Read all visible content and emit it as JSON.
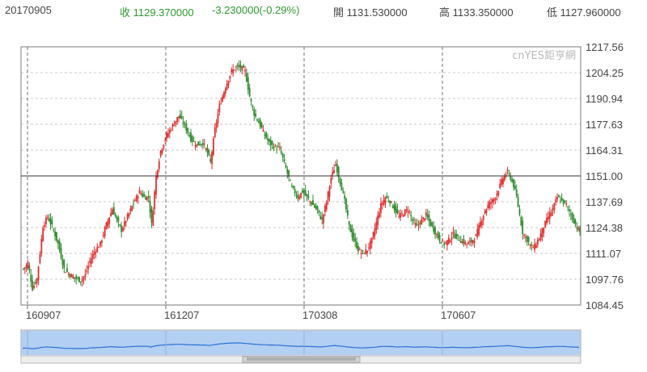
{
  "header": {
    "date": "20170905",
    "close": "收 1129.370000",
    "change": "-3.230000(-0.29%)",
    "open": "開 1131.530000",
    "high": "高 1133.350000",
    "low": "低 1127.960000"
  },
  "watermark": "cnYES鉅亨網",
  "colors": {
    "up": "#e03030",
    "down": "#2e8b2e",
    "navigator_fill": "#9cc3ef",
    "navigator_line": "#2a6fd6"
  },
  "chart_data": {
    "type": "candlestick",
    "y_ticks": [
      "1217.56",
      "1204.25",
      "1190.94",
      "1177.63",
      "1164.31",
      "1151.00",
      "1137.69",
      "1124.38",
      "1111.07",
      "1097.76",
      "1084.45"
    ],
    "ylim": [
      1084.45,
      1217.56
    ],
    "x_ticks": [
      "160907",
      "161207",
      "170308",
      "170607"
    ],
    "reference_line": 1151.0,
    "grid": true,
    "price_path": [
      [
        0,
        1103
      ],
      [
        3,
        1106
      ],
      [
        6,
        1093
      ],
      [
        9,
        1098
      ],
      [
        13,
        1125
      ],
      [
        16,
        1130
      ],
      [
        19,
        1125
      ],
      [
        23,
        1116
      ],
      [
        27,
        1103
      ],
      [
        31,
        1100
      ],
      [
        35,
        1098
      ],
      [
        38,
        1097
      ],
      [
        41,
        1100
      ],
      [
        44,
        1107
      ],
      [
        47,
        1112
      ],
      [
        51,
        1116
      ],
      [
        55,
        1126
      ],
      [
        59,
        1134
      ],
      [
        62,
        1128
      ],
      [
        65,
        1123
      ],
      [
        69,
        1130
      ],
      [
        73,
        1137
      ],
      [
        77,
        1143
      ],
      [
        80,
        1140
      ],
      [
        83,
        1140
      ],
      [
        85,
        1126
      ],
      [
        88,
        1151
      ],
      [
        91,
        1164
      ],
      [
        95,
        1172
      ],
      [
        99,
        1177
      ],
      [
        103,
        1182
      ],
      [
        107,
        1177
      ],
      [
        111,
        1170
      ],
      [
        115,
        1167
      ],
      [
        119,
        1168
      ],
      [
        122,
        1163
      ],
      [
        124,
        1158
      ],
      [
        127,
        1175
      ],
      [
        130,
        1187
      ],
      [
        134,
        1197
      ],
      [
        138,
        1205
      ],
      [
        141,
        1207
      ],
      [
        144,
        1207
      ],
      [
        147,
        1205
      ],
      [
        150,
        1192
      ],
      [
        153,
        1183
      ],
      [
        157,
        1177
      ],
      [
        160,
        1172
      ],
      [
        163,
        1168
      ],
      [
        166,
        1166
      ],
      [
        170,
        1165
      ],
      [
        174,
        1155
      ],
      [
        178,
        1145
      ],
      [
        182,
        1140
      ],
      [
        185,
        1143
      ],
      [
        188,
        1140
      ],
      [
        191,
        1137
      ],
      [
        195,
        1133
      ],
      [
        198,
        1128
      ],
      [
        201,
        1138
      ],
      [
        204,
        1150
      ],
      [
        207,
        1157
      ],
      [
        210,
        1148
      ],
      [
        213,
        1138
      ],
      [
        216,
        1125
      ],
      [
        219,
        1118
      ],
      [
        222,
        1113
      ],
      [
        225,
        1111
      ],
      [
        228,
        1113
      ],
      [
        231,
        1118
      ],
      [
        234,
        1127
      ],
      [
        237,
        1136
      ],
      [
        240,
        1140
      ],
      [
        243,
        1138
      ],
      [
        246,
        1134
      ],
      [
        249,
        1130
      ],
      [
        252,
        1132
      ],
      [
        255,
        1134
      ],
      [
        258,
        1128
      ],
      [
        261,
        1125
      ],
      [
        264,
        1128
      ],
      [
        267,
        1131
      ],
      [
        270,
        1126
      ],
      [
        273,
        1122
      ],
      [
        276,
        1118
      ],
      [
        279,
        1116
      ],
      [
        282,
        1118
      ],
      [
        285,
        1121
      ],
      [
        288,
        1119
      ],
      [
        291,
        1117
      ],
      [
        294,
        1116
      ],
      [
        297,
        1117
      ],
      [
        300,
        1120
      ],
      [
        303,
        1127
      ],
      [
        306,
        1133
      ],
      [
        309,
        1137
      ],
      [
        312,
        1139
      ],
      [
        315,
        1144
      ],
      [
        318,
        1150
      ],
      [
        321,
        1153
      ],
      [
        323,
        1150
      ],
      [
        325,
        1146
      ],
      [
        327,
        1140
      ],
      [
        329,
        1131
      ],
      [
        331,
        1122
      ],
      [
        334,
        1118
      ],
      [
        337,
        1114
      ],
      [
        339,
        1115
      ],
      [
        342,
        1119
      ],
      [
        345,
        1125
      ],
      [
        348,
        1130
      ],
      [
        351,
        1134
      ],
      [
        354,
        1140
      ],
      [
        357,
        1138
      ],
      [
        360,
        1136
      ],
      [
        363,
        1131
      ],
      [
        366,
        1126
      ],
      [
        369,
        1122
      ]
    ]
  },
  "navigator": {
    "x_ticks": [
      "160907",
      "161207",
      "170308",
      "170607"
    ]
  }
}
